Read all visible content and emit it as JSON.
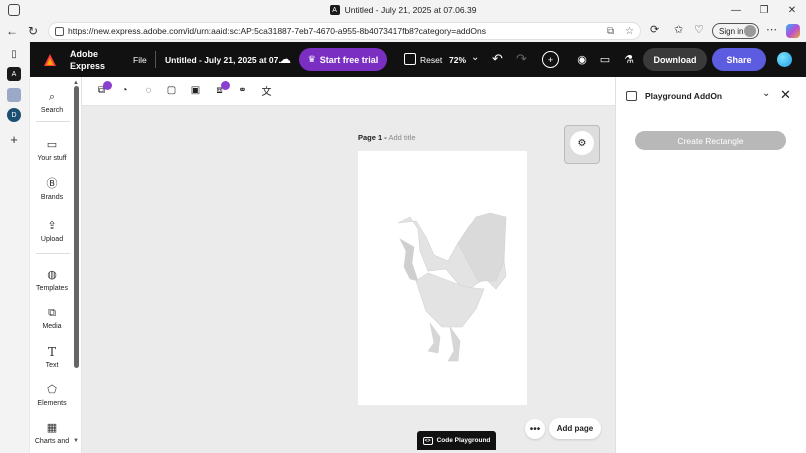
{
  "window": {
    "title": "Untitled - July 21, 2025 at 07.06.39",
    "controls": [
      "—",
      "❐",
      "✕"
    ]
  },
  "browser": {
    "url": "https://new.express.adobe.com/id/urn:aaid:sc:AP:5ca31887-7eb7-4670-a955-8b4073417fb8?category=addOns",
    "signin_label": "Sign in"
  },
  "appbar": {
    "brand_line1": "Adobe",
    "brand_line2": "Express",
    "file_label": "File",
    "doc_title": "Untitled - July 21, 2025 at 07....",
    "trial_label": "Start free trial",
    "reset_label": "Reset",
    "zoom": "72%",
    "download_label": "Download",
    "share_label": "Share"
  },
  "sidenav": {
    "items": [
      {
        "label": "Search",
        "icon": "search-icon"
      },
      {
        "label": "Your stuff",
        "icon": "folder-icon"
      },
      {
        "label": "Brands",
        "icon": "brand-icon"
      },
      {
        "label": "Upload",
        "icon": "upload-icon"
      },
      {
        "label": "Templates",
        "icon": "templates-icon"
      },
      {
        "label": "Media",
        "icon": "media-icon"
      },
      {
        "label": "Text",
        "icon": "text-icon"
      },
      {
        "label": "Elements",
        "icon": "elements-icon"
      },
      {
        "label": "Charts and",
        "icon": "charts-icon"
      }
    ]
  },
  "canvas": {
    "page_label": "Page 1 -",
    "page_title_placeholder": "Add title",
    "add_page_label": "Add page",
    "code_playground_label": "Code Playground"
  },
  "panel": {
    "title": "Playground AddOn",
    "create_button": "Create Rectangle"
  },
  "colors": {
    "appbar_bg": "#111111",
    "trial_purple": "#7a2fc2",
    "share_blue": "#5c5ce0",
    "disabled_gray": "#b8b8b8"
  }
}
